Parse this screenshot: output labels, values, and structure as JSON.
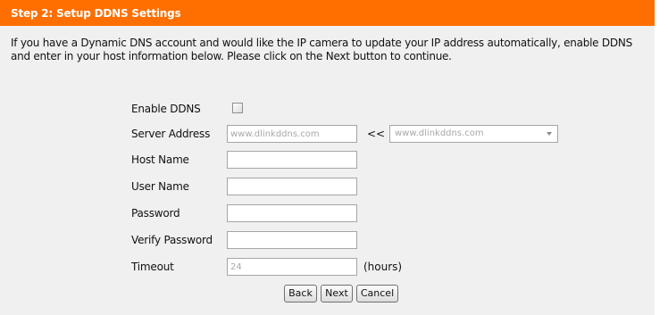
{
  "header": {
    "title": "Step 2: Setup DDNS Settings"
  },
  "description": "If you have a Dynamic DNS account and would like the IP camera to update your IP address automatically, enable DDNS and enter in your host information below. Please click on the Next button to continue.",
  "form": {
    "enable_ddns": {
      "label": "Enable DDNS",
      "checked": false
    },
    "server_address": {
      "label": "Server Address",
      "value": "www.dlinkddns.com",
      "arrows": "<<",
      "select_value": "www.dlinkddns.com"
    },
    "host_name": {
      "label": "Host Name",
      "value": ""
    },
    "user_name": {
      "label": "User Name",
      "value": ""
    },
    "password": {
      "label": "Password",
      "value": ""
    },
    "verify_password": {
      "label": "Verify Password",
      "value": ""
    },
    "timeout": {
      "label": "Timeout",
      "value": "24",
      "unit": "(hours)"
    }
  },
  "buttons": {
    "back": "Back",
    "next": "Next",
    "cancel": "Cancel"
  },
  "colors": {
    "header_bg": "#ff6f00",
    "panel_bg": "#f0f0f0"
  }
}
